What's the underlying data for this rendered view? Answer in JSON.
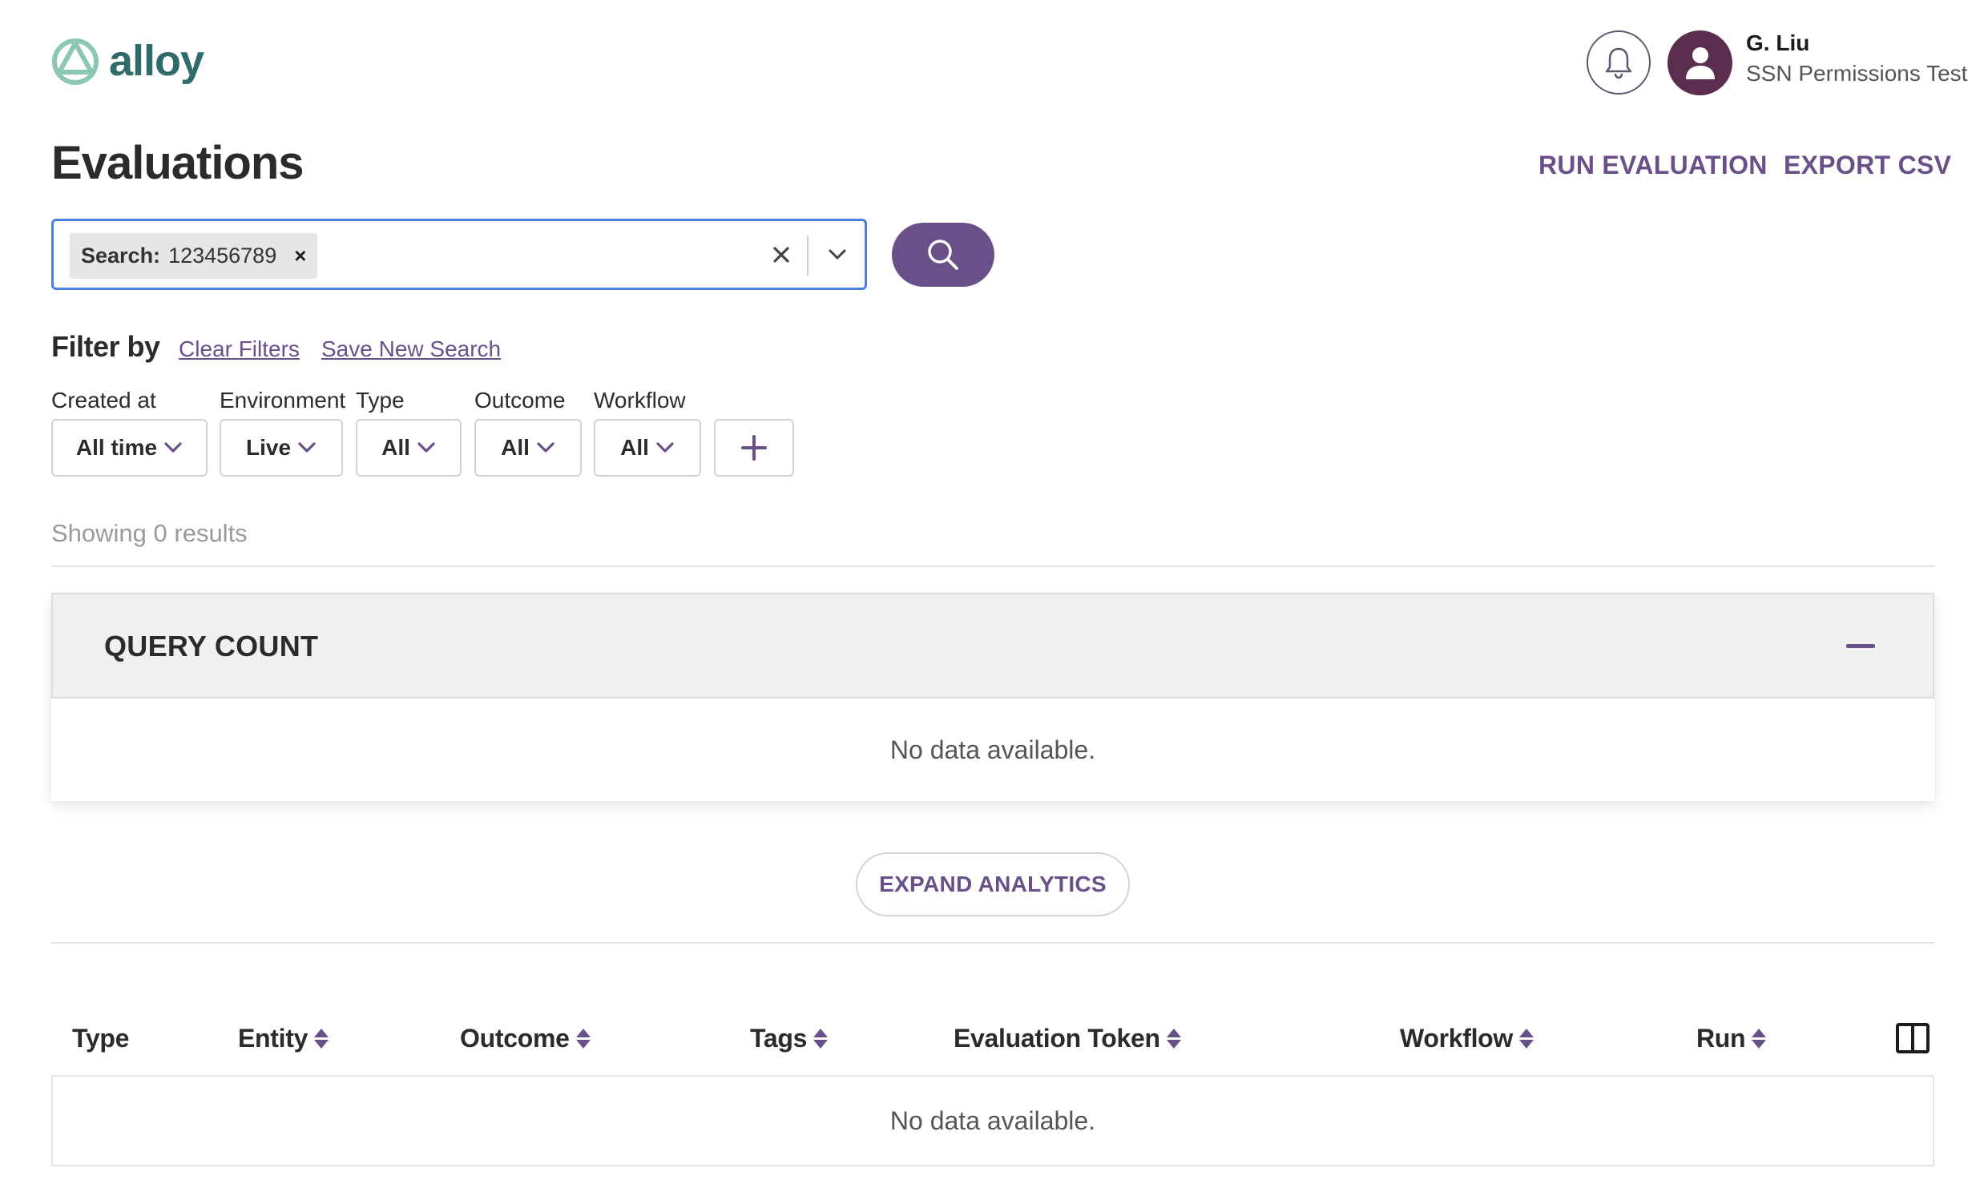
{
  "app": {
    "logo_text": "alloy",
    "brand_color": "#2f6b6b",
    "accent_color": "#6a5089"
  },
  "user": {
    "name": "G. Liu",
    "org": "SSN Permissions Test"
  },
  "page": {
    "title": "Evaluations",
    "run_evaluation": "RUN EVALUATION",
    "export_csv": "EXPORT CSV"
  },
  "search": {
    "chip_key": "Search:",
    "chip_value": "123456789",
    "chip_remove": "×"
  },
  "filters": {
    "title": "Filter by",
    "clear_filters": "Clear Filters",
    "save_new_search": "Save New Search",
    "items": [
      {
        "label": "Created at",
        "value": "All time"
      },
      {
        "label": "Environment",
        "value": "Live"
      },
      {
        "label": "Type",
        "value": "All"
      },
      {
        "label": "Outcome",
        "value": "All"
      },
      {
        "label": "Workflow",
        "value": "All"
      }
    ]
  },
  "results": {
    "showing": "Showing 0 results"
  },
  "query_count": {
    "title": "QUERY COUNT",
    "empty": "No data available."
  },
  "analytics": {
    "expand": "EXPAND ANALYTICS"
  },
  "table": {
    "columns": [
      "Type",
      "Entity",
      "Outcome",
      "Tags",
      "Evaluation Token",
      "Workflow",
      "Run"
    ],
    "empty": "No data available."
  }
}
